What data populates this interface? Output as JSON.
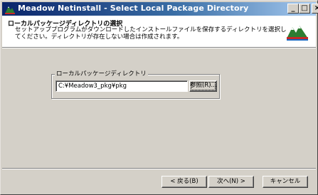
{
  "window": {
    "title": "Meadow Netinstall - Select Local Package Directory",
    "controls": {
      "minimize": "_",
      "maximize": "□",
      "close": "×"
    }
  },
  "header": {
    "title": "ローカルパッケージディレクトリの選択",
    "desc_line1": "セットアッププログラムがダウンロードしたインストールファイルを保存するディレクトリを選択し",
    "desc_line2": "てください。ディレクトリが存在しない場合は作成されます。",
    "icon": "meadow-logo-icon"
  },
  "group": {
    "label": "ローカルパッケージディレクトリ",
    "path_value": "C:¥Meadow3_pkg¥pkg",
    "browse_label": "参照(R)..."
  },
  "footer": {
    "back_label": "< 戻る(B)",
    "next_label": "次へ(N) >",
    "cancel_label": "キャンセル"
  }
}
